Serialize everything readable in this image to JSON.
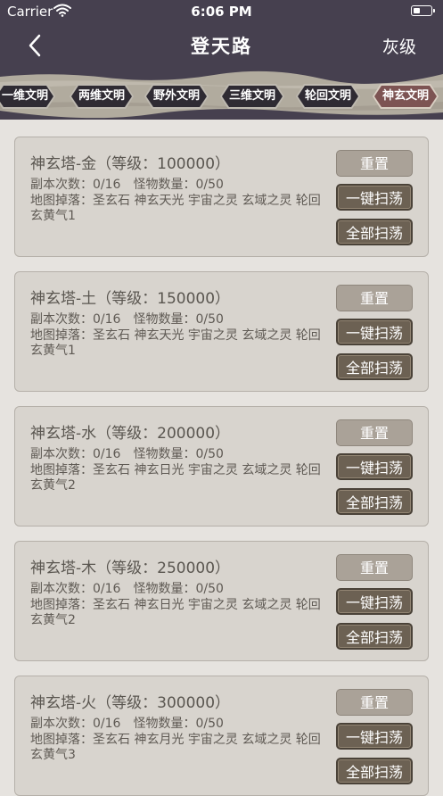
{
  "status_bar": {
    "carrier": "Carrier",
    "time": "6:06 PM"
  },
  "nav": {
    "title": "登天路",
    "right": "灰级"
  },
  "tabs": [
    {
      "label": "一维文明",
      "active": false
    },
    {
      "label": "两维文明",
      "active": false
    },
    {
      "label": "野外文明",
      "active": false
    },
    {
      "label": "三维文明",
      "active": false
    },
    {
      "label": "轮回文明",
      "active": false
    },
    {
      "label": "神玄文明",
      "active": true
    }
  ],
  "buttons": {
    "reset": "重置",
    "sweep_one": "一键扫荡",
    "sweep_all": "全部扫荡"
  },
  "cards": [
    {
      "name": "神玄塔-金（等级：100000）",
      "count": "副本次数：0/16",
      "monsters": "怪物数量：0/50",
      "drop": "地图掉落：圣玄石 神玄天光 宇宙之灵 玄域之灵 轮回玄黄气1"
    },
    {
      "name": "神玄塔-土（等级：150000）",
      "count": "副本次数：0/16",
      "monsters": "怪物数量：0/50",
      "drop": "地图掉落：圣玄石 神玄天光 宇宙之灵 玄域之灵 轮回玄黄气1"
    },
    {
      "name": "神玄塔-水（等级：200000）",
      "count": "副本次数：0/16",
      "monsters": "怪物数量：0/50",
      "drop": "地图掉落：圣玄石 神玄日光 宇宙之灵 玄域之灵 轮回玄黄气2"
    },
    {
      "name": "神玄塔-木（等级：250000）",
      "count": "副本次数：0/16",
      "monsters": "怪物数量：0/50",
      "drop": "地图掉落：圣玄石 神玄日光 宇宙之灵 玄域之灵 轮回玄黄气2"
    },
    {
      "name": "神玄塔-火（等级：300000）",
      "count": "副本次数：0/16",
      "monsters": "怪物数量：0/50",
      "drop": "地图掉落：圣玄石 神玄月光 宇宙之灵 玄域之灵 轮回玄黄气3"
    }
  ]
}
